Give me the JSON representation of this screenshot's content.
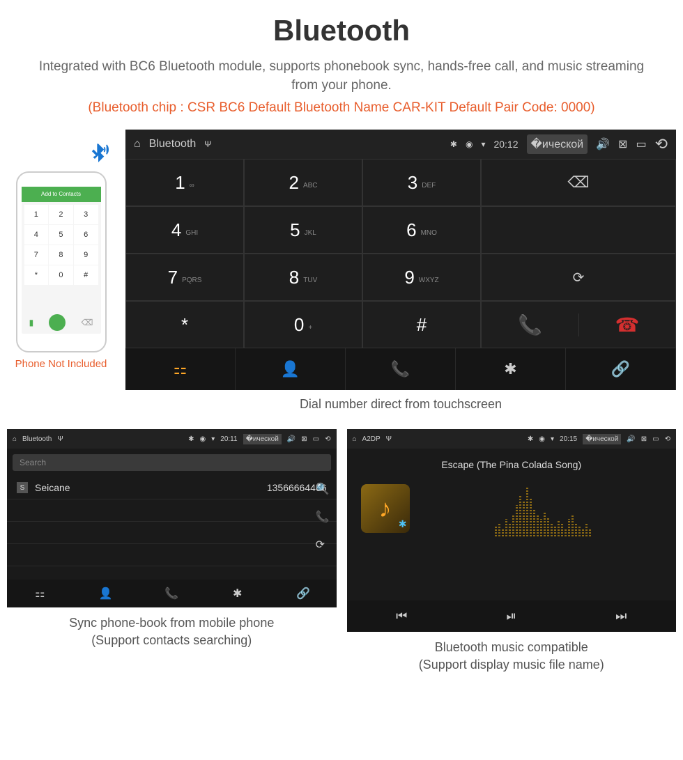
{
  "header": {
    "title": "Bluetooth",
    "subtitle": "Integrated with BC6 Bluetooth module, supports phonebook sync, hands-free call, and music streaming from your phone.",
    "specs": "(Bluetooth chip : CSR BC6    Default Bluetooth Name CAR-KIT    Default Pair Code: 0000)"
  },
  "phone": {
    "header": "Add to Contacts",
    "caption": "Phone Not Included"
  },
  "dialer": {
    "status_title": "Bluetooth",
    "time": "20:12",
    "keys": [
      {
        "num": "1",
        "let": "∞"
      },
      {
        "num": "2",
        "let": "ABC"
      },
      {
        "num": "3",
        "let": "DEF"
      },
      {
        "num": "4",
        "let": "GHI"
      },
      {
        "num": "5",
        "let": "JKL"
      },
      {
        "num": "6",
        "let": "MNO"
      },
      {
        "num": "7",
        "let": "PQRS"
      },
      {
        "num": "8",
        "let": "TUV"
      },
      {
        "num": "9",
        "let": "WXYZ"
      },
      {
        "num": "*",
        "let": ""
      },
      {
        "num": "0",
        "let": "+"
      },
      {
        "num": "#",
        "let": ""
      }
    ],
    "caption": "Dial number direct from touchscreen"
  },
  "phonebook": {
    "status_title": "Bluetooth",
    "time": "20:11",
    "search_placeholder": "Search",
    "contact_badge": "S",
    "contact_name": "Seicane",
    "contact_number": "13566664466",
    "caption_l1": "Sync phone-book from mobile phone",
    "caption_l2": "(Support contacts searching)"
  },
  "music": {
    "status_title": "A2DP",
    "time": "20:15",
    "song": "Escape (The Pina Colada Song)",
    "caption_l1": "Bluetooth music compatible",
    "caption_l2": "(Support display music file name)"
  }
}
